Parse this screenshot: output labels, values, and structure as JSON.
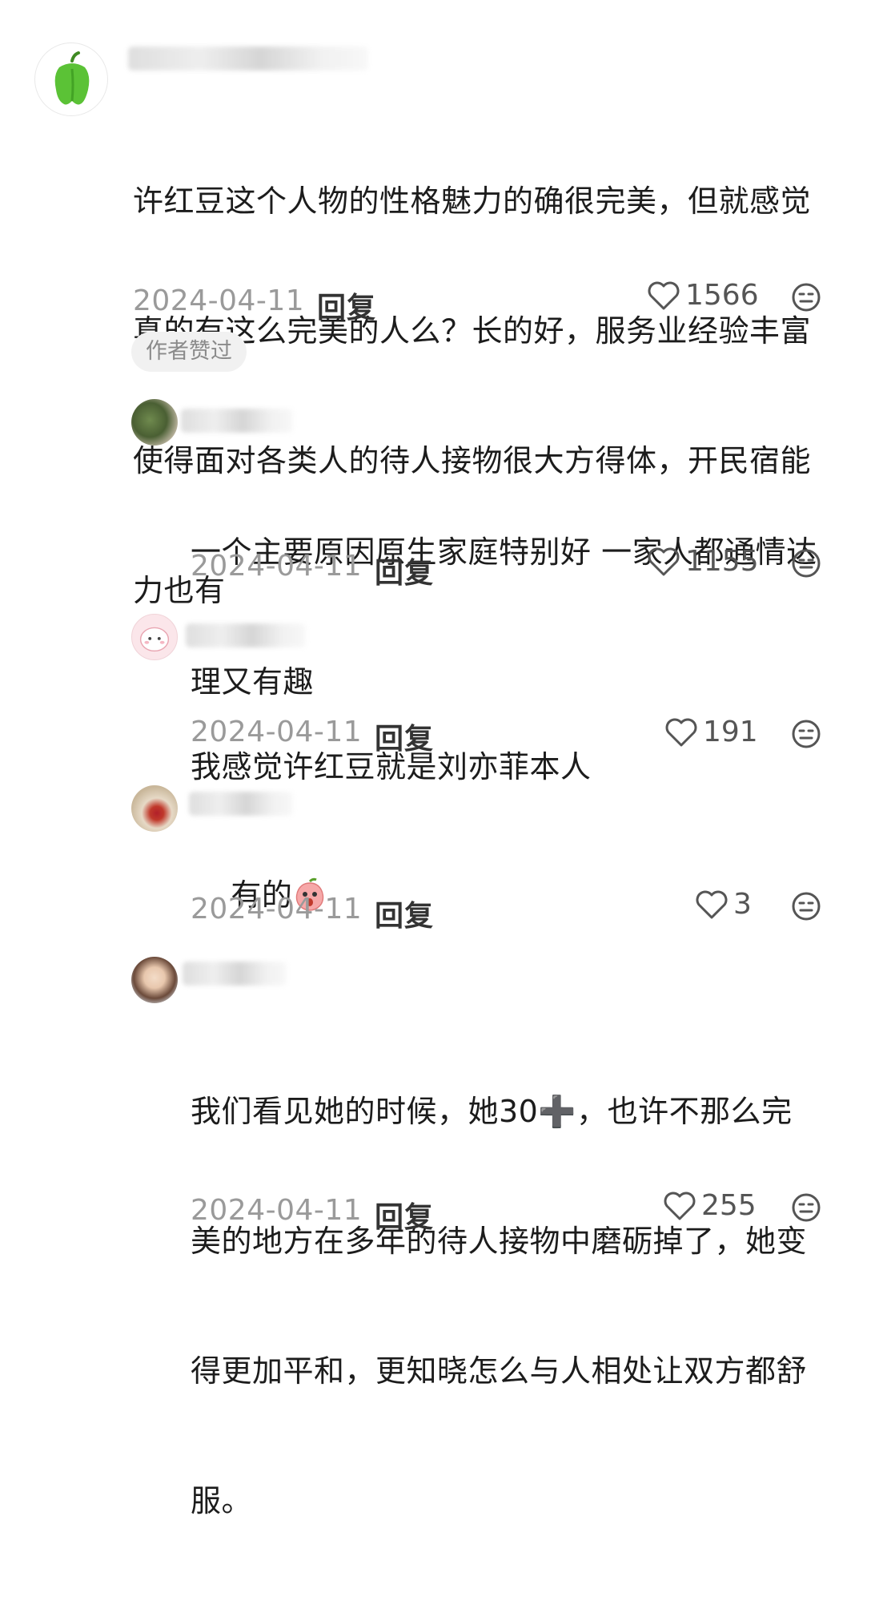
{
  "comments": [
    {
      "text": "许红豆这个人物的性格魅力的确很完美，但就感觉真的有这么完美的人么？长的好，服务业经验丰富使得面对各类人的待人接物很大方得体，开民宿能力也有",
      "lines": [
        "许红豆这个人物的性格魅力的确很完美，但就感觉",
        "真的有这么完美的人么？长的好，服务业经验丰富",
        "使得面对各类人的待人接物很大方得体，开民宿能",
        "力也有"
      ],
      "date": "2024-04-11",
      "reply": "回复",
      "likes": "1566",
      "badge": "作者赞过",
      "avatar_icon": "green-pepper-icon"
    }
  ],
  "replies": [
    {
      "lines": [
        "一个主要原因原生家庭特别好 一家人都通情达",
        "理又有趣"
      ],
      "date": "2024-04-11",
      "reply": "回复",
      "likes": "1155"
    },
    {
      "lines": [
        "我感觉许红豆就是刘亦菲本人"
      ],
      "date": "2024-04-11",
      "reply": "回复",
      "likes": "191"
    },
    {
      "lines": [
        "有的"
      ],
      "emoji": "peach-shocked-emoji",
      "date": "2024-04-11",
      "reply": "回复",
      "likes": "3"
    },
    {
      "lines": [
        "我们看见她的时候，她30➕，也许不那么完",
        "美的地方在多年的待人接物中磨砺掉了，她变",
        "得更加平和，更知晓怎么与人相处让双方都舒",
        "服。"
      ],
      "date": "2024-04-11",
      "reply": "回复",
      "likes": "255"
    }
  ],
  "colors": {
    "text": "#1c1c1c",
    "meta": "#9a9a9a",
    "badge_bg": "#f1f1f1",
    "pepper": "#5bc236"
  }
}
